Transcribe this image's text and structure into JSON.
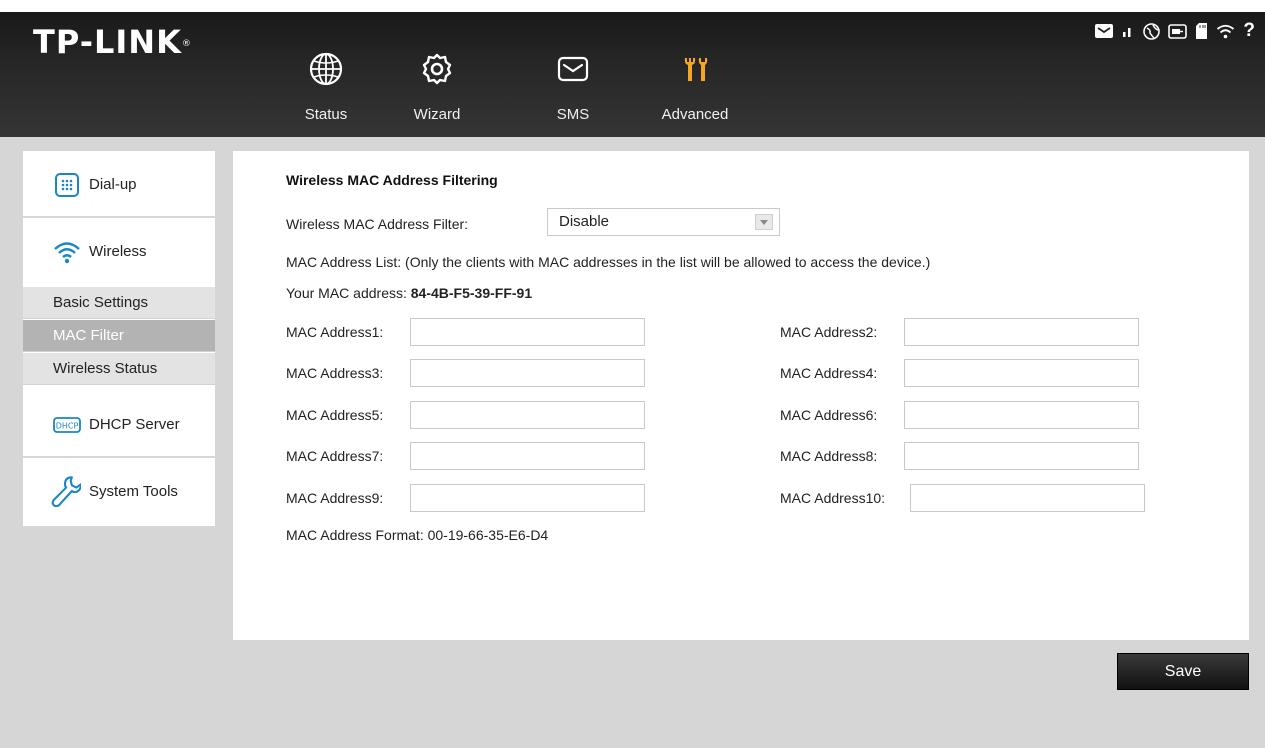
{
  "header": {
    "logo": "TP-LINK",
    "logo_mark": "®",
    "nav": [
      {
        "label": "Status",
        "icon": "globe-icon"
      },
      {
        "label": "Wizard",
        "icon": "gear-icon"
      },
      {
        "label": "SMS",
        "icon": "envelope-icon"
      },
      {
        "label": "Advanced",
        "icon": "tools-icon"
      }
    ],
    "active_color": "#f5a623",
    "status_icons": [
      "message-icon",
      "signal-icon",
      "globe-status-icon",
      "battery-icon",
      "sd-card-icon",
      "wifi-icon",
      "help-icon"
    ],
    "help_glyph": "?"
  },
  "sidebar": {
    "sections": [
      {
        "label": "Dial-up",
        "icon": "dialup-icon"
      },
      {
        "label": "Wireless",
        "icon": "wifi-icon"
      },
      {
        "label": "DHCP Server",
        "icon": "dhcp-icon",
        "icon_text": "DHCP"
      },
      {
        "label": "System Tools",
        "icon": "wrench-icon"
      }
    ],
    "wireless_sub": [
      {
        "label": "Basic Settings",
        "active": false
      },
      {
        "label": "MAC Filter",
        "active": true
      },
      {
        "label": "Wireless Status",
        "active": false
      }
    ],
    "accent_color": "#1a85c8"
  },
  "main": {
    "title": "Wireless MAC Address Filtering",
    "filter_label": "Wireless MAC Address Filter:",
    "filter_value": "Disable",
    "list_note": "MAC Address List: (Only the clients with MAC addresses in the list will be allowed to access the device.)",
    "your_mac_label": "Your MAC address:",
    "your_mac_value": "84-4B-F5-39-FF-91",
    "mac_fields": [
      {
        "label": "MAC Address1:",
        "value": ""
      },
      {
        "label": "MAC Address2:",
        "value": ""
      },
      {
        "label": "MAC Address3:",
        "value": ""
      },
      {
        "label": "MAC Address4:",
        "value": ""
      },
      {
        "label": "MAC Address5:",
        "value": ""
      },
      {
        "label": "MAC Address6:",
        "value": ""
      },
      {
        "label": "MAC Address7:",
        "value": ""
      },
      {
        "label": "MAC Address8:",
        "value": ""
      },
      {
        "label": "MAC Address9:",
        "value": ""
      },
      {
        "label": "MAC Address10:",
        "value": ""
      }
    ],
    "format_note": "MAC Address Format: 00-19-66-35-E6-D4"
  },
  "footer": {
    "save_label": "Save"
  }
}
